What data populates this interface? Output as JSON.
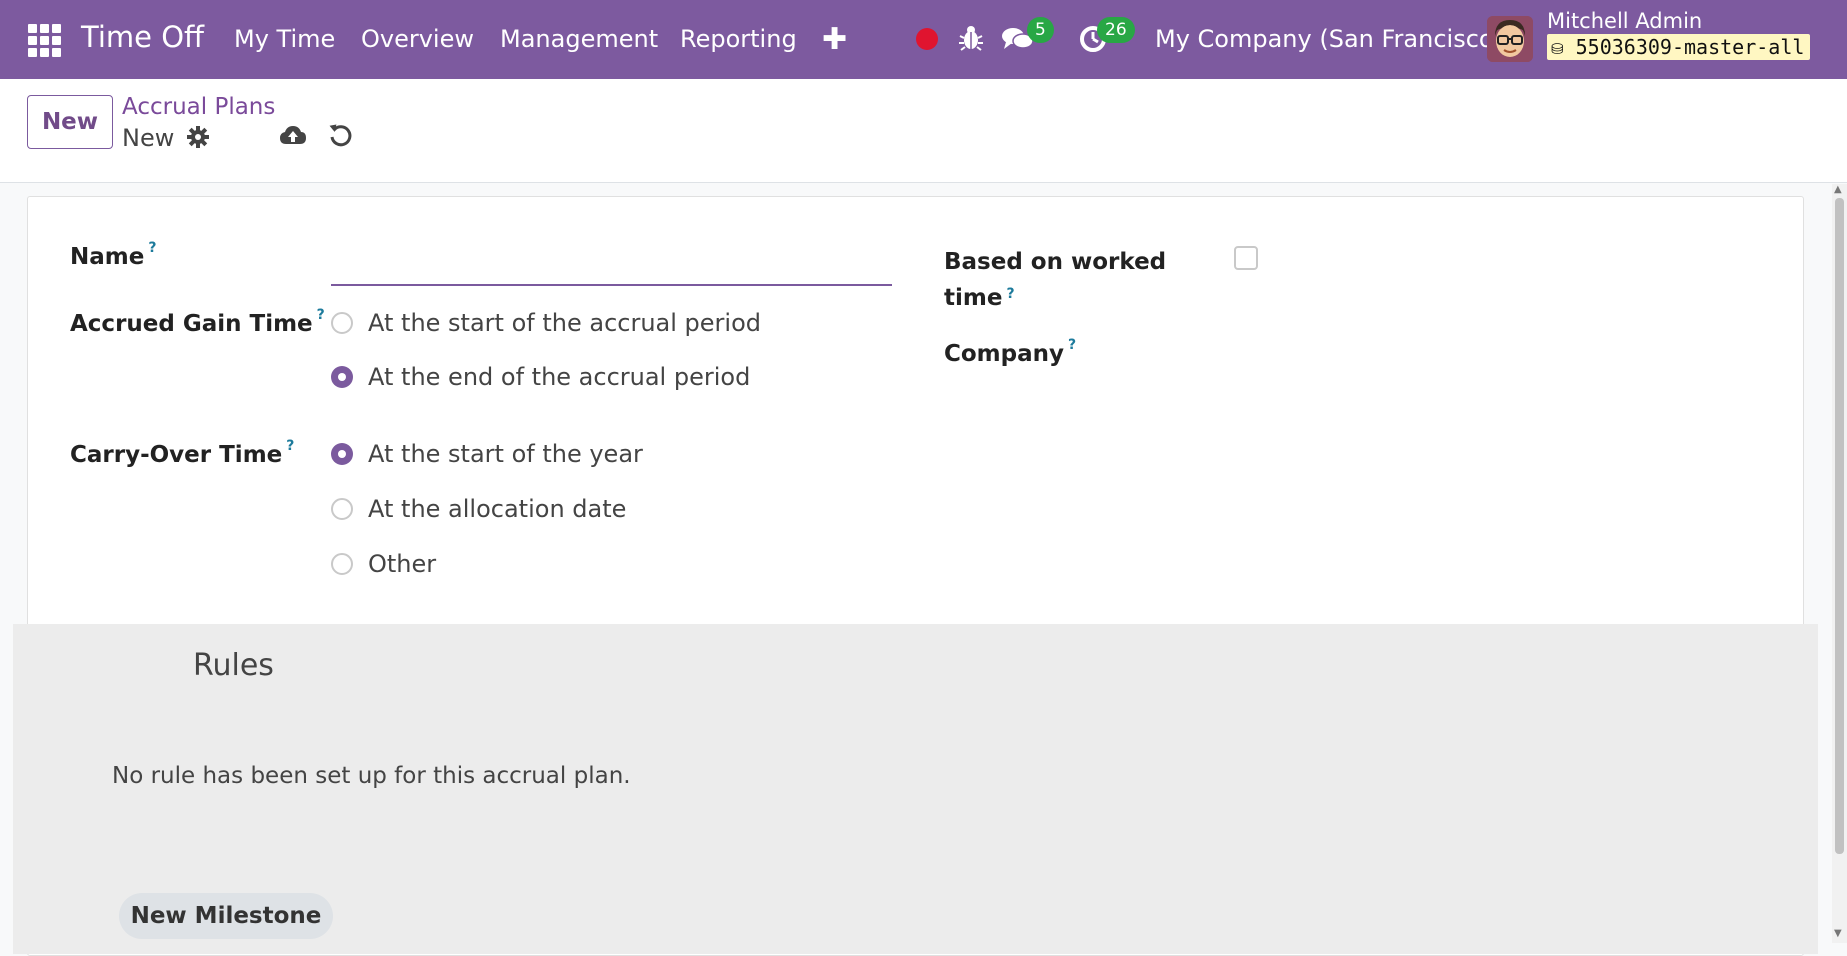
{
  "navbar": {
    "app_title": "Time Off",
    "menu": [
      "My Time",
      "Overview",
      "Management",
      "Reporting"
    ],
    "messages_count": "5",
    "activities_count": "26",
    "company": "My Company (San Francisco)",
    "user_name": "Mitchell Admin",
    "database": "55036309-master-all",
    "colors": {
      "navbar_bg": "#7d5a9f",
      "badge": "#28a745",
      "record": "#e0142f"
    }
  },
  "control_panel": {
    "new_button": "New",
    "breadcrumb_parent": "Accrual Plans",
    "breadcrumb_current": "New"
  },
  "form": {
    "name_label": "Name",
    "name_value": "",
    "help_mark": "?",
    "accrued_gain_label": "Accrued Gain Time",
    "accrued_gain_options": [
      "At the start of the accrual period",
      "At the end of the accrual period"
    ],
    "accrued_gain_selected": "At the end of the accrual period",
    "carry_over_label": "Carry-Over Time",
    "carry_over_options": [
      "At the start of the year",
      "At the allocation date",
      "Other"
    ],
    "carry_over_selected": "At the start of the year",
    "based_on_worked_line1": "Based on worked",
    "based_on_worked_line2": "time",
    "based_on_worked_checked": false,
    "company_label": "Company"
  },
  "rules": {
    "title": "Rules",
    "empty_text": "No rule has been set up for this accrual plan.",
    "new_milestone_button": "New Milestone"
  }
}
